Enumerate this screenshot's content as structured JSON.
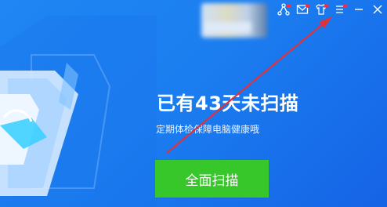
{
  "header": {
    "tools": [
      {
        "name": "share-icon",
        "has_badge": true
      },
      {
        "name": "mail-icon",
        "has_badge": true
      },
      {
        "name": "skin-shirt-icon",
        "has_badge": true
      },
      {
        "name": "menu-icon",
        "has_badge": true
      },
      {
        "name": "minimize-icon",
        "has_badge": false
      },
      {
        "name": "close-icon",
        "has_badge": false
      }
    ]
  },
  "main": {
    "headline": "已有43天未扫描",
    "subline": "定期体检保障电脑健康哦",
    "scan_button_label": "全面扫描"
  },
  "colors": {
    "background": "#1b7ef0",
    "badge": "#ff2a3b",
    "scan_button": "#37c72a",
    "annotation_arrow": "#e0323c"
  }
}
